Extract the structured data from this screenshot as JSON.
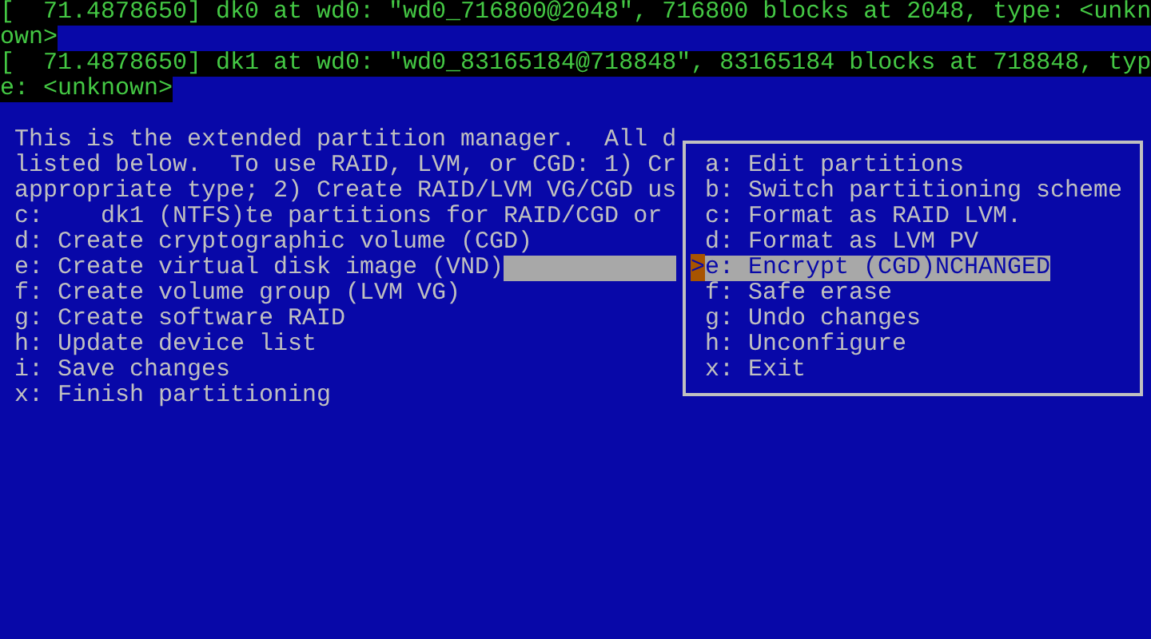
{
  "boot_log": [
    "[  71.4878650] dk0 at wd0: \"wd0_716800@2048\", 716800 blocks at 2048, type: <unkn",
    "own>",
    "[  71.4878650] dk1 at wd0: \"wd0_83165184@718848\", 83165184 blocks at 718848, typ",
    "e: <unknown>"
  ],
  "main_menu": {
    "intro": [
      "This is the extended partition manager.  All d",
      "listed below.  To use RAID, LVM, or CGD: 1) Cr",
      "appropriate type; 2) Create RAID/LVM VG/CGD us",
      "c:    dk1 (NTFS)te partitions for RAID/CGD or"
    ],
    "items": [
      {
        "label": "d: Create cryptographic volume (CGD)",
        "selected": false
      },
      {
        "label": "e: Create virtual disk image (VND)",
        "selected": true
      },
      {
        "label": "f: Create volume group (LVM VG)",
        "selected": false
      },
      {
        "label": "g: Create software RAID",
        "selected": false
      },
      {
        "label": "h: Update device list",
        "selected": false
      },
      {
        "label": "i: Save changes",
        "selected": false
      },
      {
        "label": "x: Finish partitioning",
        "selected": false
      }
    ]
  },
  "popup_menu": {
    "cursor": ">",
    "items": [
      {
        "label": "a: Edit partitions",
        "selected": false
      },
      {
        "label": "b: Switch partitioning scheme",
        "selected": false
      },
      {
        "label": "c: Format as RAID LVM.",
        "selected": false
      },
      {
        "label": "d: Format as LVM PV",
        "selected": false
      },
      {
        "label": "e: Encrypt (CGD)NCHANGED",
        "selected": true
      },
      {
        "label": "f: Safe erase",
        "selected": false
      },
      {
        "label": "g: Undo changes",
        "selected": false
      },
      {
        "label": "h: Unconfigure",
        "selected": false
      },
      {
        "label": "x: Exit",
        "selected": false
      }
    ]
  }
}
